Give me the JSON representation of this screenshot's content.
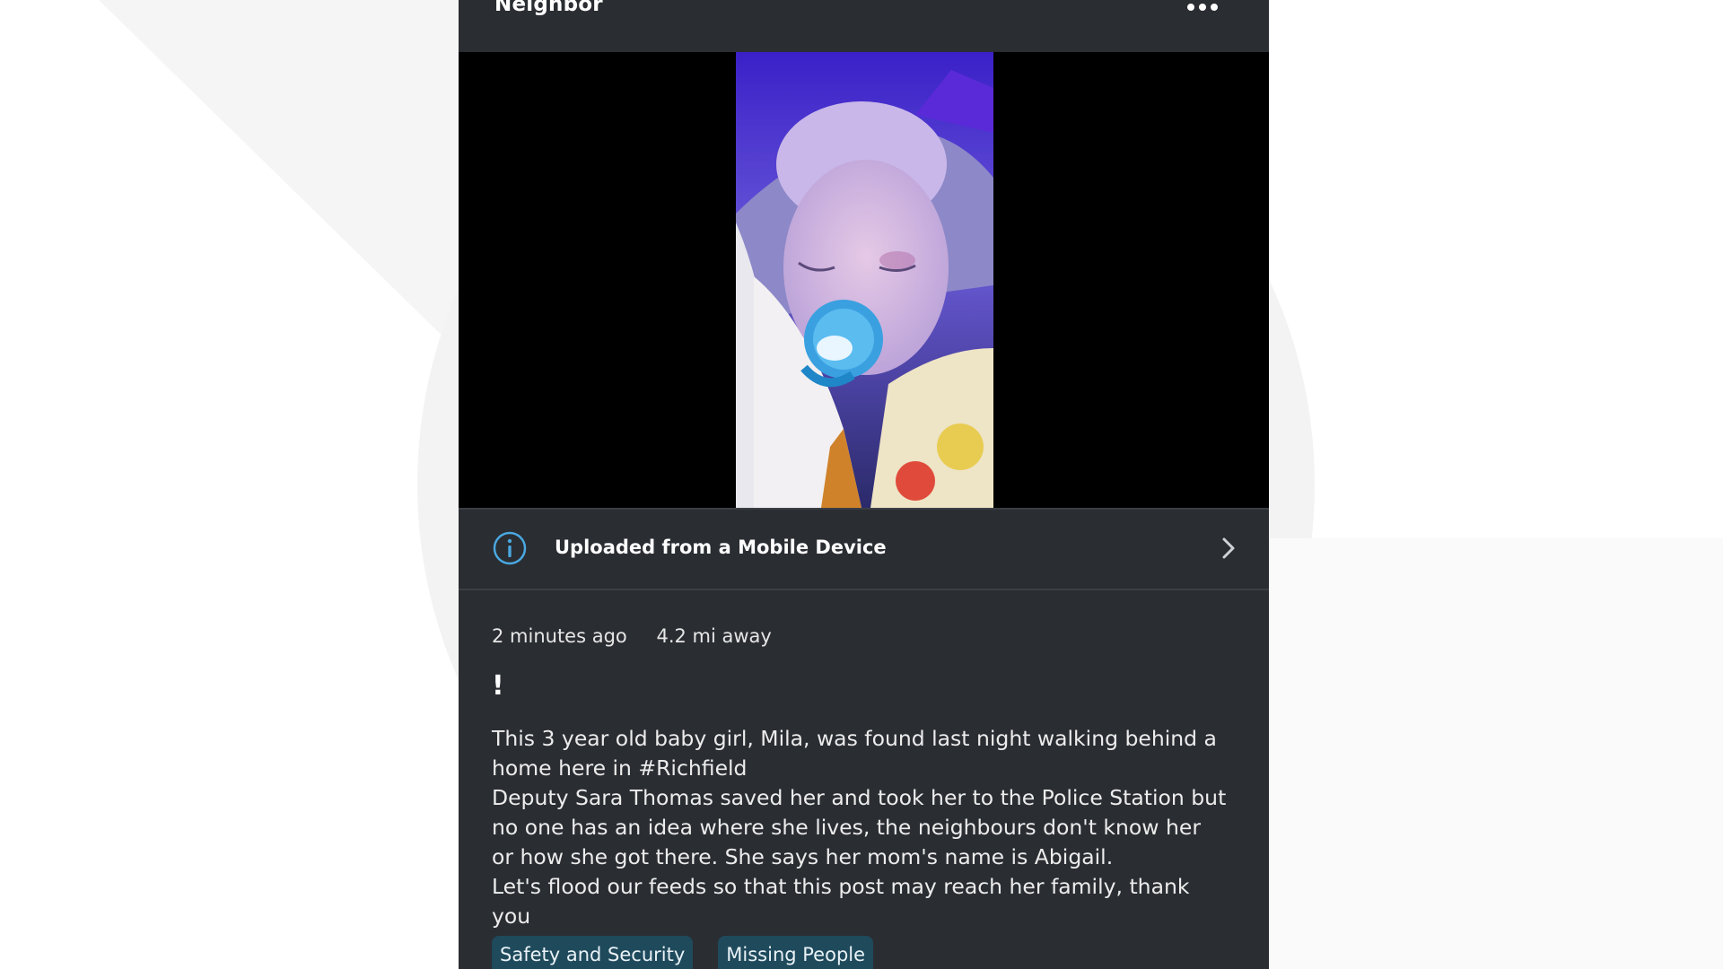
{
  "app": {
    "title": "Neighbor"
  },
  "header": {
    "more_icon": "more-horizontal-icon"
  },
  "media": {
    "photo_description_icon": "image",
    "source_row": {
      "icon": "info-icon",
      "label": "Uploaded from a Mobile Device",
      "chevron": "chevron-right-icon"
    }
  },
  "post": {
    "time_ago": "2 minutes ago",
    "distance": "4.2 mi away",
    "title": "!",
    "body_lines": [
      "This 3 year old baby girl, Mila, was found last night walking behind a home here in #Richfield",
      "Deputy Sara Thomas saved her and took her to the Police Station but no one has an idea where she lives, the neighbours don't know her or how she got there. She says her mom's name is Abigail.",
      "Let's flood our feeds so that this post may reach her family, thank you"
    ],
    "tags": [
      "Safety and Security",
      "Missing People"
    ]
  },
  "colors": {
    "panel": "#2a2d32",
    "accent": "#4aa8e0",
    "tag_bg": "#1f4a5c"
  }
}
